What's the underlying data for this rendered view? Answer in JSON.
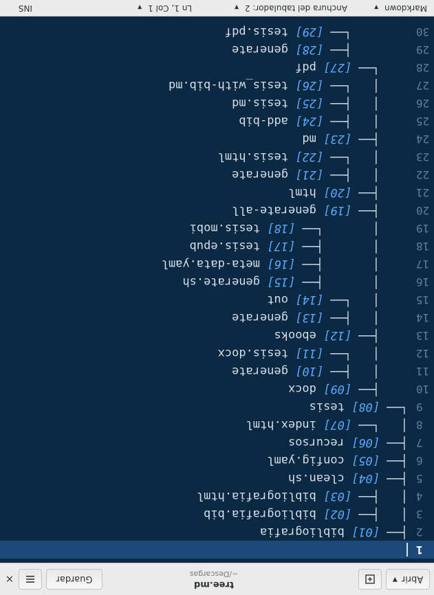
{
  "header": {
    "open_label": "Abrir",
    "new_tab_icon": "new-tab-icon",
    "title": "tree.md",
    "path": "~/Descargas",
    "save_label": "Guardar",
    "menu_icon": "hamburger-menu-icon",
    "close_symbol": "×"
  },
  "editor": {
    "current_line": 1,
    "lines": [
      {
        "n": "1",
        "tree": "",
        "num": "",
        "text": ""
      },
      {
        "n": "2",
        "tree": "├── ",
        "num": "[01]",
        "text": " bibliografia"
      },
      {
        "n": "3",
        "tree": "│   ├── ",
        "num": "[02]",
        "text": " bibliografia.bib"
      },
      {
        "n": "4",
        "tree": "│   ├── ",
        "num": "[03]",
        "text": " bibliografia.html"
      },
      {
        "n": "5",
        "tree": "├── ",
        "num": "[04]",
        "text": " clean.sh"
      },
      {
        "n": "6",
        "tree": "├── ",
        "num": "[05]",
        "text": " config.yaml"
      },
      {
        "n": "7",
        "tree": "├── ",
        "num": "[06]",
        "text": " recursos"
      },
      {
        "n": "8",
        "tree": "│   └── ",
        "num": "[07]",
        "text": " index.html"
      },
      {
        "n": "9",
        "tree": "└── ",
        "num": "[08]",
        "text": " tesis"
      },
      {
        "n": "10",
        "tree": "    ├── ",
        "num": "[09]",
        "text": " docx"
      },
      {
        "n": "11",
        "tree": "    │   ├── ",
        "num": "[10]",
        "text": " generate"
      },
      {
        "n": "12",
        "tree": "    │   └── ",
        "num": "[11]",
        "text": " tesis.docx"
      },
      {
        "n": "13",
        "tree": "    ├── ",
        "num": "[12]",
        "text": " ebooks"
      },
      {
        "n": "14",
        "tree": "    │   ├── ",
        "num": "[13]",
        "text": " generate"
      },
      {
        "n": "15",
        "tree": "    │   └── ",
        "num": "[14]",
        "text": " out"
      },
      {
        "n": "16",
        "tree": "    │       ├── ",
        "num": "[15]",
        "text": " generate.sh"
      },
      {
        "n": "17",
        "tree": "    │       ├── ",
        "num": "[16]",
        "text": " meta-data.yaml"
      },
      {
        "n": "18",
        "tree": "    │       ├── ",
        "num": "[17]",
        "text": " tesis.epub"
      },
      {
        "n": "19",
        "tree": "    │       └── ",
        "num": "[18]",
        "text": " tesis.mobi"
      },
      {
        "n": "20",
        "tree": "    ├── ",
        "num": "[19]",
        "text": " generate-all"
      },
      {
        "n": "21",
        "tree": "    ├── ",
        "num": "[20]",
        "text": " html"
      },
      {
        "n": "22",
        "tree": "    │   ├── ",
        "num": "[21]",
        "text": " generate"
      },
      {
        "n": "23",
        "tree": "    │   └── ",
        "num": "[22]",
        "text": " tesis.html"
      },
      {
        "n": "24",
        "tree": "    ├── ",
        "num": "[23]",
        "text": " md"
      },
      {
        "n": "25",
        "tree": "    │   ├── ",
        "num": "[24]",
        "text": " add-bib"
      },
      {
        "n": "26",
        "tree": "    │   ├── ",
        "num": "[25]",
        "text": " tesis.md"
      },
      {
        "n": "27",
        "tree": "    │   └── ",
        "num": "[26]",
        "text": " tesis_with-bib.md"
      },
      {
        "n": "28",
        "tree": "    └── ",
        "num": "[27]",
        "text": " pdf"
      },
      {
        "n": "29",
        "tree": "        ├── ",
        "num": "[28]",
        "text": " generate"
      },
      {
        "n": "30",
        "tree": "        └── ",
        "num": "[29]",
        "text": " tesis.pdf"
      }
    ]
  },
  "statusbar": {
    "language": "Markdown",
    "tab_width": "Anchura del tabulador: 2",
    "position": "Ln 1, Col 1",
    "mode": "INS"
  }
}
